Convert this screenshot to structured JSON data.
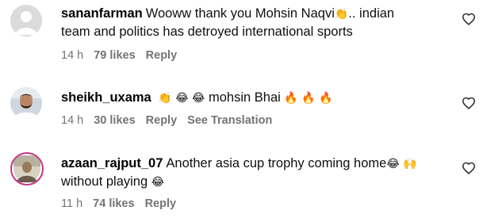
{
  "comments": [
    {
      "username": "sananfarman",
      "text_line1": "Wooww thank you Mohsin Naqvi",
      "emoji1": "👏",
      "text_line1_tail": ".. indian",
      "text_line2": "team and politics has detroyed international sports",
      "time": "14 h",
      "likes": "79 likes",
      "reply": "Reply"
    },
    {
      "username": "sheikh_uxama",
      "emoji_pre": "👏 😂 😂",
      "text": "mohsin Bhai",
      "emoji_post": "🔥 🔥 🔥",
      "time": "14 h",
      "likes": "30 likes",
      "reply": "Reply",
      "translate": "See Translation"
    },
    {
      "username": "azaan_rajput_07",
      "text_line1": "Another asia cup trophy coming home",
      "emoji1": "😂 🙌",
      "text_line2": "without playing",
      "emoji2": "😂",
      "time": "11 h",
      "likes": "74 likes",
      "reply": "Reply"
    }
  ],
  "icons": {
    "avatar_default": "default-avatar-icon",
    "heart": "heart-outline-icon"
  },
  "colors": {
    "meta": "#737373",
    "avatar_ring": "#c13584"
  }
}
